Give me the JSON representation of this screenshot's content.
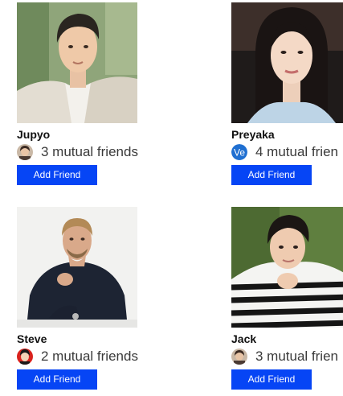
{
  "friend_suggestions": [
    {
      "name": "Jupyo",
      "mutual_text": "3 mutual friends",
      "mutual_avatar_icon": "profile-photo-icon",
      "button_label": "Add Friend"
    },
    {
      "name": "Preyaka",
      "mutual_text": "4 mutual frien",
      "mutual_avatar_icon": "ve-badge-icon",
      "mutual_avatar_text": "Ve",
      "button_label": "Add Friend"
    },
    {
      "name": "Steve",
      "mutual_text": "2 mutual friends",
      "mutual_avatar_icon": "profile-photo-icon",
      "button_label": "Add Friend"
    },
    {
      "name": "Jack",
      "mutual_text": "3 mutual frien",
      "mutual_avatar_icon": "profile-photo-icon",
      "button_label": "Add Friend"
    }
  ],
  "colors": {
    "button": "#0645f5",
    "button_text": "#ffffff",
    "name_text": "#111111",
    "mutual_text": "#3a3a3a"
  }
}
